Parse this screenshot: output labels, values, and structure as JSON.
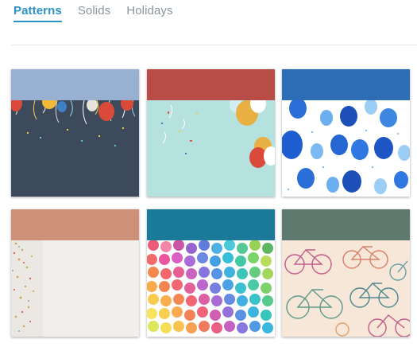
{
  "tabs": [
    {
      "label": "Patterns",
      "active": true
    },
    {
      "label": "Solids",
      "active": false
    },
    {
      "label": "Holidays",
      "active": false
    }
  ],
  "cards": [
    {
      "name": "confetti-dark",
      "band_color": "#98b0d1",
      "bg_color": "#3c4a5c"
    },
    {
      "name": "balloons-aqua",
      "band_color": "#b84c46",
      "bg_color": "#b5e2df"
    },
    {
      "name": "blue-balloons",
      "band_color": "#2c6db5",
      "bg_color": "#ffffff"
    },
    {
      "name": "sparkle-silver",
      "band_color": "#cf907a",
      "bg_color": "#ebe8e3"
    },
    {
      "name": "watercolor-dots",
      "band_color": "#1b7a9a",
      "bg_color": "#ffffff"
    },
    {
      "name": "bicycles",
      "band_color": "#5e7a6f",
      "bg_color": "#f6e7d8"
    }
  ]
}
